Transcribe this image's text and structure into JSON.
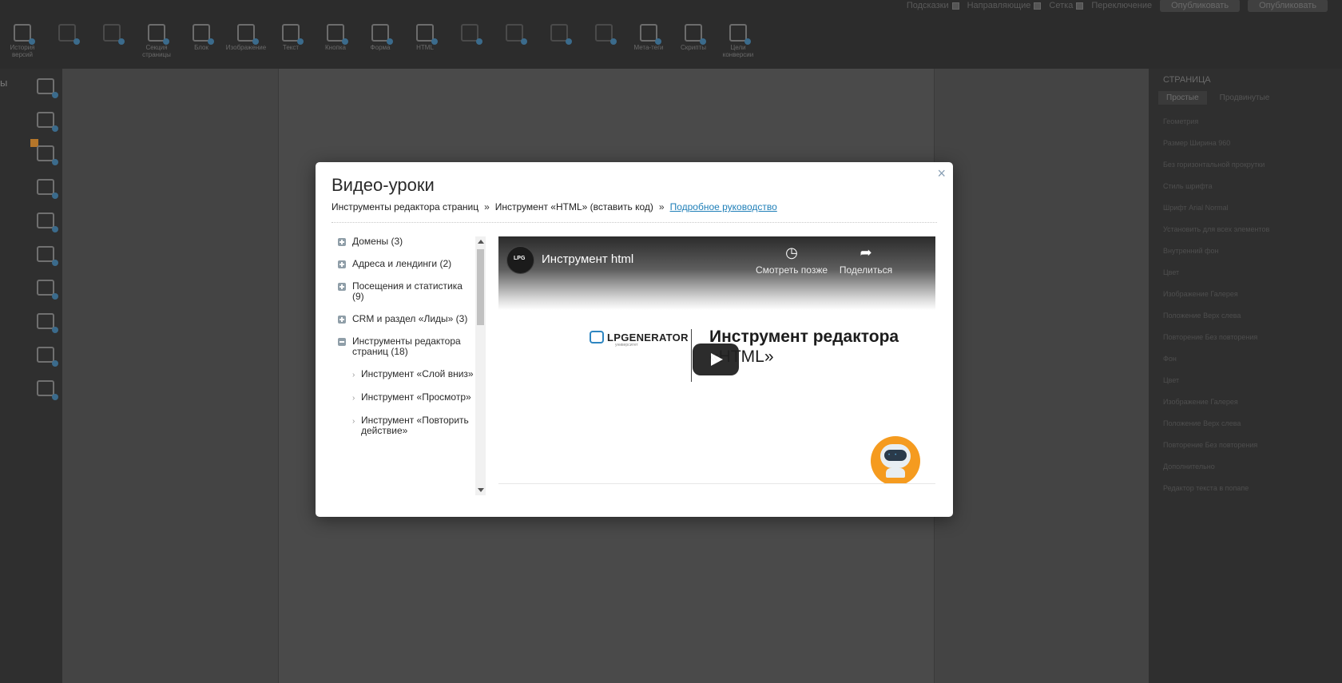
{
  "topbar": {
    "checks": [
      "Подсказки",
      "Направляющие",
      "Сетка",
      "Переключение"
    ],
    "buttons": [
      "Опубликовать",
      "Опубликовать"
    ]
  },
  "tools": [
    {
      "label": "История версий",
      "icon": "history-icon",
      "dim": false
    },
    {
      "label": "",
      "icon": "layers-icon",
      "dim": true
    },
    {
      "label": "",
      "icon": "clone-icon",
      "dim": true
    },
    {
      "label": "Секция страницы",
      "icon": "section-icon",
      "dim": false
    },
    {
      "label": "Блок",
      "icon": "block-icon",
      "dim": false
    },
    {
      "label": "Изображение",
      "icon": "image-icon",
      "dim": false
    },
    {
      "label": "Текст",
      "icon": "text-icon",
      "dim": false
    },
    {
      "label": "Кнопка",
      "icon": "button-icon",
      "dim": false
    },
    {
      "label": "Форма",
      "icon": "form-icon",
      "dim": false
    },
    {
      "label": "HTML",
      "icon": "html-icon",
      "dim": false
    },
    {
      "label": "",
      "icon": "video-tool-icon",
      "dim": true
    },
    {
      "label": "",
      "icon": "gallery-tool-icon",
      "dim": true
    },
    {
      "label": "",
      "icon": "widget-tool-icon",
      "dim": true
    },
    {
      "label": "",
      "icon": "timer-tool-icon",
      "dim": true
    },
    {
      "label": "Мета-теги",
      "icon": "meta-tags-icon",
      "dim": false
    },
    {
      "label": "Скрипты",
      "icon": "scripts-icon",
      "dim": false
    },
    {
      "label": "Цели конверсии",
      "icon": "conversion-icon",
      "dim": false
    }
  ],
  "leftbar": {
    "label": "ы"
  },
  "rightpanel": {
    "title": "СТРАНИЦА",
    "tabs": [
      "Простые",
      "Продвинутые"
    ],
    "rows": [
      "Геометрия",
      "Размер      Ширина  960",
      "Без горизонтальной прокрутки",
      "Стиль шрифта",
      "Шрифт      Arial      Normal",
      "Установить для всех элементов",
      "Внутренний фон",
      "Цвет",
      "Изображение   Галерея",
      "Положение     Верх слева",
      "Повторение    Без повторения",
      "Фон",
      "Цвет",
      "Изображение   Галерея",
      "Положение     Верх слева",
      "Повторение    Без повторения",
      "Дополнительно",
      "Редактор текста в попапе"
    ]
  },
  "modal": {
    "title": "Видео-уроки",
    "close": "×",
    "breadcrumbs": [
      "Инструменты редактора страниц",
      "Инструмент «HTML» (вставить код)"
    ],
    "breadcrumb_sep": "»",
    "guide_link": "Подробное руководство",
    "tree": [
      {
        "label": "Домены (3)",
        "expanded": false
      },
      {
        "label": "Адреса и лендинги (2)",
        "expanded": false
      },
      {
        "label": "Посещения и статистика (9)",
        "expanded": false
      },
      {
        "label": "CRM и раздел «Лиды» (3)",
        "expanded": false
      },
      {
        "label": "Инструменты редактора страниц (18)",
        "expanded": true
      }
    ],
    "subitems": [
      "Инструмент «Слой вниз»",
      "Инструмент «Просмотр»",
      "Инструмент «Повторить действие»"
    ],
    "subitem_chevrons": [
      "›",
      "›",
      "›"
    ],
    "video": {
      "title": "Инструмент html",
      "watch_later": "Смотреть позже",
      "share": "Поделиться",
      "brand": "LPGENERATOR",
      "brand_sub": "университет",
      "headline": "Инструмент редактора",
      "headline2": "«HTML»"
    }
  }
}
